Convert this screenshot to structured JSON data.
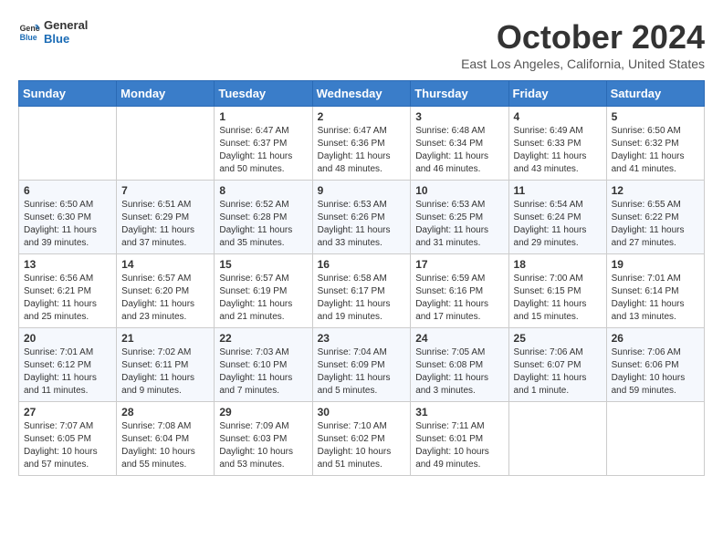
{
  "header": {
    "logo_line1": "General",
    "logo_line2": "Blue",
    "month_title": "October 2024",
    "subtitle": "East Los Angeles, California, United States"
  },
  "weekdays": [
    "Sunday",
    "Monday",
    "Tuesday",
    "Wednesday",
    "Thursday",
    "Friday",
    "Saturday"
  ],
  "weeks": [
    [
      {
        "day": "",
        "info": ""
      },
      {
        "day": "",
        "info": ""
      },
      {
        "day": "1",
        "info": "Sunrise: 6:47 AM\nSunset: 6:37 PM\nDaylight: 11 hours and 50 minutes."
      },
      {
        "day": "2",
        "info": "Sunrise: 6:47 AM\nSunset: 6:36 PM\nDaylight: 11 hours and 48 minutes."
      },
      {
        "day": "3",
        "info": "Sunrise: 6:48 AM\nSunset: 6:34 PM\nDaylight: 11 hours and 46 minutes."
      },
      {
        "day": "4",
        "info": "Sunrise: 6:49 AM\nSunset: 6:33 PM\nDaylight: 11 hours and 43 minutes."
      },
      {
        "day": "5",
        "info": "Sunrise: 6:50 AM\nSunset: 6:32 PM\nDaylight: 11 hours and 41 minutes."
      }
    ],
    [
      {
        "day": "6",
        "info": "Sunrise: 6:50 AM\nSunset: 6:30 PM\nDaylight: 11 hours and 39 minutes."
      },
      {
        "day": "7",
        "info": "Sunrise: 6:51 AM\nSunset: 6:29 PM\nDaylight: 11 hours and 37 minutes."
      },
      {
        "day": "8",
        "info": "Sunrise: 6:52 AM\nSunset: 6:28 PM\nDaylight: 11 hours and 35 minutes."
      },
      {
        "day": "9",
        "info": "Sunrise: 6:53 AM\nSunset: 6:26 PM\nDaylight: 11 hours and 33 minutes."
      },
      {
        "day": "10",
        "info": "Sunrise: 6:53 AM\nSunset: 6:25 PM\nDaylight: 11 hours and 31 minutes."
      },
      {
        "day": "11",
        "info": "Sunrise: 6:54 AM\nSunset: 6:24 PM\nDaylight: 11 hours and 29 minutes."
      },
      {
        "day": "12",
        "info": "Sunrise: 6:55 AM\nSunset: 6:22 PM\nDaylight: 11 hours and 27 minutes."
      }
    ],
    [
      {
        "day": "13",
        "info": "Sunrise: 6:56 AM\nSunset: 6:21 PM\nDaylight: 11 hours and 25 minutes."
      },
      {
        "day": "14",
        "info": "Sunrise: 6:57 AM\nSunset: 6:20 PM\nDaylight: 11 hours and 23 minutes."
      },
      {
        "day": "15",
        "info": "Sunrise: 6:57 AM\nSunset: 6:19 PM\nDaylight: 11 hours and 21 minutes."
      },
      {
        "day": "16",
        "info": "Sunrise: 6:58 AM\nSunset: 6:17 PM\nDaylight: 11 hours and 19 minutes."
      },
      {
        "day": "17",
        "info": "Sunrise: 6:59 AM\nSunset: 6:16 PM\nDaylight: 11 hours and 17 minutes."
      },
      {
        "day": "18",
        "info": "Sunrise: 7:00 AM\nSunset: 6:15 PM\nDaylight: 11 hours and 15 minutes."
      },
      {
        "day": "19",
        "info": "Sunrise: 7:01 AM\nSunset: 6:14 PM\nDaylight: 11 hours and 13 minutes."
      }
    ],
    [
      {
        "day": "20",
        "info": "Sunrise: 7:01 AM\nSunset: 6:12 PM\nDaylight: 11 hours and 11 minutes."
      },
      {
        "day": "21",
        "info": "Sunrise: 7:02 AM\nSunset: 6:11 PM\nDaylight: 11 hours and 9 minutes."
      },
      {
        "day": "22",
        "info": "Sunrise: 7:03 AM\nSunset: 6:10 PM\nDaylight: 11 hours and 7 minutes."
      },
      {
        "day": "23",
        "info": "Sunrise: 7:04 AM\nSunset: 6:09 PM\nDaylight: 11 hours and 5 minutes."
      },
      {
        "day": "24",
        "info": "Sunrise: 7:05 AM\nSunset: 6:08 PM\nDaylight: 11 hours and 3 minutes."
      },
      {
        "day": "25",
        "info": "Sunrise: 7:06 AM\nSunset: 6:07 PM\nDaylight: 11 hours and 1 minute."
      },
      {
        "day": "26",
        "info": "Sunrise: 7:06 AM\nSunset: 6:06 PM\nDaylight: 10 hours and 59 minutes."
      }
    ],
    [
      {
        "day": "27",
        "info": "Sunrise: 7:07 AM\nSunset: 6:05 PM\nDaylight: 10 hours and 57 minutes."
      },
      {
        "day": "28",
        "info": "Sunrise: 7:08 AM\nSunset: 6:04 PM\nDaylight: 10 hours and 55 minutes."
      },
      {
        "day": "29",
        "info": "Sunrise: 7:09 AM\nSunset: 6:03 PM\nDaylight: 10 hours and 53 minutes."
      },
      {
        "day": "30",
        "info": "Sunrise: 7:10 AM\nSunset: 6:02 PM\nDaylight: 10 hours and 51 minutes."
      },
      {
        "day": "31",
        "info": "Sunrise: 7:11 AM\nSunset: 6:01 PM\nDaylight: 10 hours and 49 minutes."
      },
      {
        "day": "",
        "info": ""
      },
      {
        "day": "",
        "info": ""
      }
    ]
  ]
}
